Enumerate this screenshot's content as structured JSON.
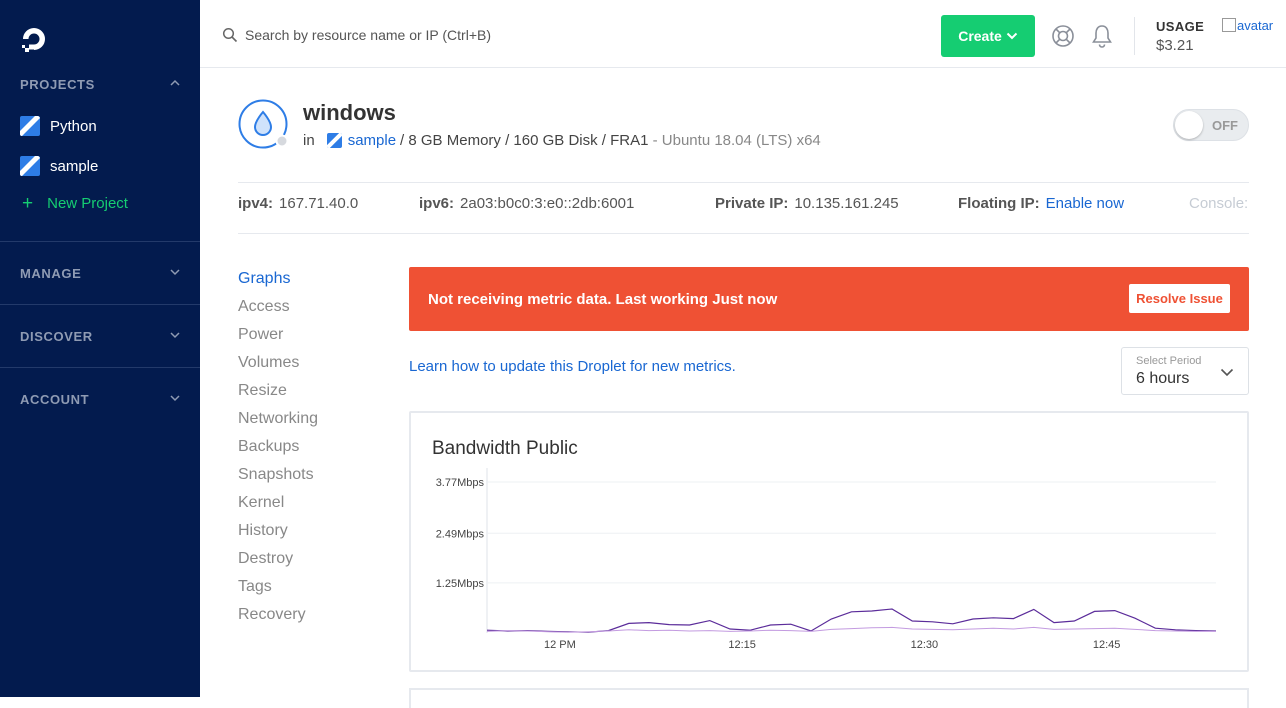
{
  "sidebar": {
    "sections": {
      "projects": "PROJECTS",
      "manage": "MANAGE",
      "discover": "DISCOVER",
      "account": "ACCOUNT"
    },
    "projects": [
      {
        "label": "Python"
      },
      {
        "label": "sample"
      }
    ],
    "new_project_label": "New Project"
  },
  "topbar": {
    "search_placeholder": "Search by resource name or IP (Ctrl+B)",
    "create_label": "Create",
    "usage_label": "USAGE",
    "usage_value": "$3.21",
    "avatar_alt": "avatar"
  },
  "droplet": {
    "name": "windows",
    "in_label": "in",
    "project": "sample",
    "specs": "/ 8 GB Memory / 160 GB Disk / FRA1",
    "os": "- Ubuntu 18.04 (LTS) x64",
    "power_toggle": "OFF",
    "ipv4_label": "ipv4:",
    "ipv4": "167.71.40.0",
    "ipv6_label": "ipv6:",
    "ipv6": "2a03:b0c0:3:e0::2db:6001",
    "private_ip_label": "Private IP:",
    "private_ip": "10.135.161.245",
    "floating_ip_label": "Floating IP:",
    "floating_ip_action": "Enable now",
    "console_label": "Console:"
  },
  "subnav": [
    "Graphs",
    "Access",
    "Power",
    "Volumes",
    "Resize",
    "Networking",
    "Backups",
    "Snapshots",
    "Kernel",
    "History",
    "Destroy",
    "Tags",
    "Recovery"
  ],
  "alert": {
    "message": "Not receiving metric data. Last working Just now",
    "button": "Resolve Issue"
  },
  "learn_link": "Learn how to update this Droplet for new metrics.",
  "period": {
    "caption": "Select Period",
    "value": "6 hours"
  },
  "colors": {
    "sidebar_bg": "#031b4e",
    "accent_green": "#15cd72",
    "link_blue": "#1967d2",
    "alert_red": "#ef5134",
    "series_inbound": "#5b2c9a",
    "series_outbound": "#c39be0"
  },
  "chart_data": {
    "type": "line",
    "title": "Bandwidth Public",
    "y_ticks": [
      "3.77Mbps",
      "2.49Mbps",
      "1.25Mbps"
    ],
    "y_tick_values": [
      3.77,
      2.49,
      1.25
    ],
    "ylim": [
      0,
      3.77
    ],
    "x_ticks": [
      "12 PM",
      "12:15",
      "12:30",
      "12:45"
    ],
    "x_tick_positions": [
      0.1,
      0.35,
      0.6,
      0.85
    ],
    "grid": true,
    "series": [
      {
        "values": [
          0.07,
          0.05,
          0.06,
          0.04,
          0.03,
          0.02,
          0.06,
          0.24,
          0.26,
          0.21,
          0.2,
          0.31,
          0.1,
          0.07,
          0.2,
          0.22,
          0.05,
          0.35,
          0.53,
          0.55,
          0.6,
          0.3,
          0.28,
          0.23,
          0.35,
          0.38,
          0.36,
          0.59,
          0.26,
          0.3,
          0.54,
          0.56,
          0.37,
          0.12,
          0.08,
          0.06,
          0.05
        ]
      },
      {
        "values": [
          0.04,
          0.06,
          0.05,
          0.03,
          0.02,
          0.03,
          0.05,
          0.08,
          0.06,
          0.07,
          0.05,
          0.06,
          0.04,
          0.05,
          0.07,
          0.06,
          0.04,
          0.09,
          0.11,
          0.13,
          0.14,
          0.1,
          0.09,
          0.08,
          0.1,
          0.12,
          0.1,
          0.14,
          0.09,
          0.1,
          0.11,
          0.12,
          0.09,
          0.06,
          0.05,
          0.04,
          0.04
        ]
      }
    ]
  }
}
